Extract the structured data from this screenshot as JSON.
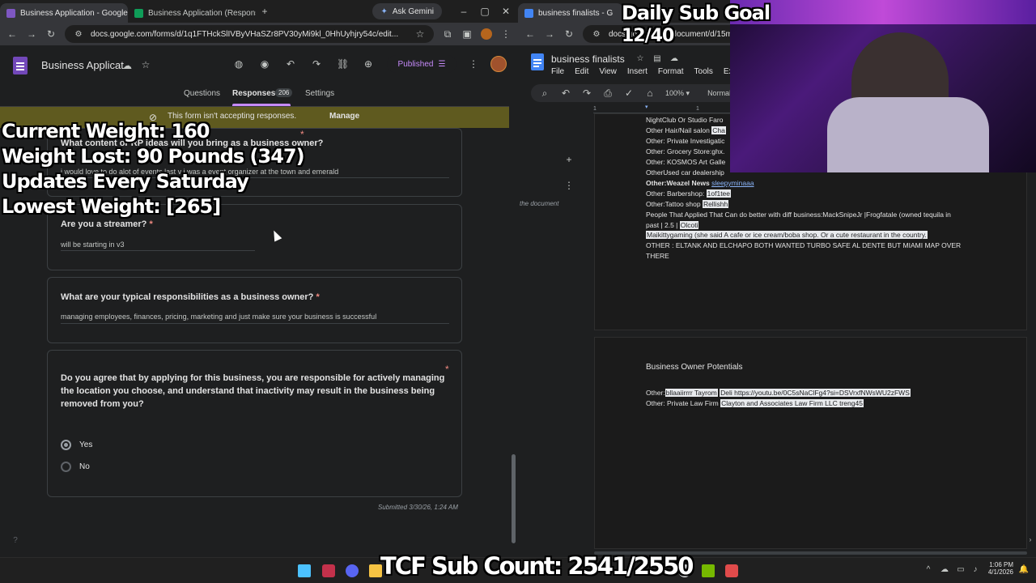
{
  "left_browser": {
    "tabs": [
      {
        "label": "Business Application - Google F",
        "active": true
      },
      {
        "label": "Business Application (Response",
        "active": false
      }
    ],
    "ask_gemini": "Ask Gemini",
    "url": "docs.google.com/forms/d/1q1FTHckSlIVByVHaSZr8PV30yMi9kl_0HhUyhjry54c/edit..."
  },
  "forms": {
    "title": "Business Applicat",
    "published": "Published",
    "tabs": {
      "questions": "Questions",
      "responses": "Responses",
      "responses_count": "206",
      "settings": "Settings"
    },
    "banner": {
      "text": "This form isn't accepting responses.",
      "manage": "Manage"
    },
    "q1": {
      "title": "What content or RP ideas will you bring as a business owner?",
      "answer": "i would love to do alot of events last v i was a event organizer at the town and emerald"
    },
    "q2": {
      "title": "Are you a streamer?",
      "answer": "will be starting in v3"
    },
    "q3": {
      "title": "What are your typical responsibilities as a business owner?",
      "answer": "managing employees, finances, pricing, marketing and just make sure your business is successful"
    },
    "q4": {
      "title": "Do you agree that by applying for this business, you are responsible for actively managing the location you choose, and understand that inactivity may result in the business being removed from you?",
      "options": [
        "Yes",
        "No"
      ],
      "selected": "Yes"
    },
    "submitted": "Submitted 3/30/26, 1:24 AM",
    "required_mark": "*"
  },
  "stream_overlay": {
    "current_weight": "Current Weight: 160",
    "weight_lost": "Weight Lost: 90 Pounds (347)",
    "updates": "Updates Every Saturday",
    "lowest_weight": "Lowest Weight: [265]",
    "daily_goal_title": "Daily Sub Goal",
    "daily_goal_value": "12/40",
    "sub_count": "TCF Sub Count: 2541/2550"
  },
  "right_browser": {
    "tab_label": "business finalists - G",
    "url": "docs.google.com/document/d/15mfM",
    "doc_title": "business finalists",
    "menu": [
      "File",
      "Edit",
      "View",
      "Insert",
      "Format",
      "Tools",
      "Exten"
    ],
    "zoom": "100%",
    "style": "Normal text",
    "outline_hint": "the document",
    "ruler_marks": [
      "1",
      "1"
    ],
    "lines": [
      {
        "pre": "NightClub Or Studio Faro",
        "hl": "",
        "post": ""
      },
      {
        "pre": "Other Hair/Nail salon ",
        "hl": "Cha",
        "post": ""
      },
      {
        "pre": "Other: Private Investigatic",
        "hl": "",
        "post": ""
      },
      {
        "pre": "Other: Grocery Store:ghx.",
        "hl": "",
        "post": ""
      },
      {
        "pre": "Other: KOSMOS Art Galle",
        "hl": "",
        "post": ""
      },
      {
        "pre": "OtherUsed car dealership ",
        "hl": "",
        "post": ""
      },
      {
        "pre": "Other:Weazel News ",
        "hl": "",
        "post": "sleepyminaaa"
      },
      {
        "pre": "Other: Barbershop: ",
        "hl": "1of1tee",
        "post": ""
      },
      {
        "pre": "Other:Tattoo shop ",
        "hl": "Rellishh",
        "post": ""
      },
      {
        "pre": "People That Applied That Can do better with diff business:MackSnipeJr |Frogfatale (owned tequila in",
        "hl": "",
        "post": ""
      },
      {
        "pre": "past | 2.5 | ",
        "hl": "Olcoti",
        "post": ""
      },
      {
        "pre": "",
        "hl": "Maikittygaming (she said A cafe or ice cream/boba shop. Or a cute restaurant in the country.",
        "post": ""
      },
      {
        "pre": "OTHER : ELTANK AND ELCHAPO BOTH WANTED TURBO SAFE AL DENTE BUT MIAMI MAP OVER",
        "hl": "",
        "post": ""
      },
      {
        "pre": "THERE",
        "hl": "",
        "post": ""
      }
    ],
    "page2_heading": "Business Owner Potentials",
    "page2_lines": [
      {
        "pre": "Other:",
        "hl": "bllaaiirrrr Tayrom",
        "mid": " ",
        "hl2": "Deli https://youtu.be/0C5sNaClFg4?si=DSVrxfNWsWU2zFWS"
      },
      {
        "pre": "Other:  Private Law Firm ",
        "hl": "Clayton and Associates Law Firm LLC treng45",
        "mid": "",
        "hl2": ""
      }
    ]
  },
  "taskbar": {
    "time": "1:06 PM",
    "date": "4/1/2026"
  },
  "colors": {
    "accent_purple": "#a142f4",
    "banner_bg": "#5f5a1f",
    "stream_bg": "#2a1246"
  }
}
